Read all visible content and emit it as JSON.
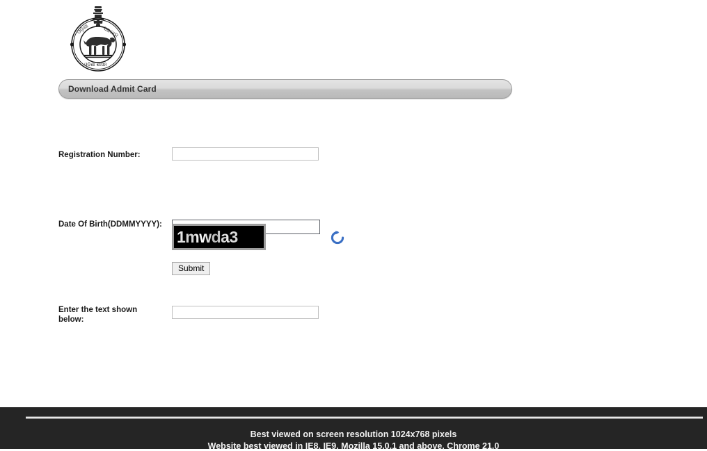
{
  "page": {
    "background_color": "#ffffff"
  },
  "emblem": {
    "name": "government-of-odisha-emblem",
    "alt": "Government of Odisha State Emblem"
  },
  "header": {
    "title": "Download Admit Card",
    "background_color": "#dadada"
  },
  "form": {
    "fields": [
      {
        "key": "registration_number",
        "label": "Registration Number:",
        "value": "",
        "placeholder": "",
        "focused": false
      },
      {
        "key": "date_of_birth",
        "label": "Date Of Birth(DDMMYYYY):",
        "value": "",
        "placeholder": "",
        "focused": true
      },
      {
        "key": "captcha_answer",
        "label": "Enter the text shown below:",
        "value": "",
        "placeholder": "",
        "focused": false
      }
    ],
    "captcha": {
      "text": "1mwda3",
      "background_color": "#000000",
      "border_color": "#9e9e9e",
      "refresh_icon": "refresh-icon",
      "refresh_icon_color": "#3a6fc4"
    },
    "submit_label": "Submit"
  },
  "footer": {
    "background_color": "#252525",
    "lines": [
      "Best viewed on screen resolution 1024x768 pixels",
      "Website best viewed in IE8, IE9, Mozilla 15.0.1 and above, Chrome 21.0"
    ]
  }
}
